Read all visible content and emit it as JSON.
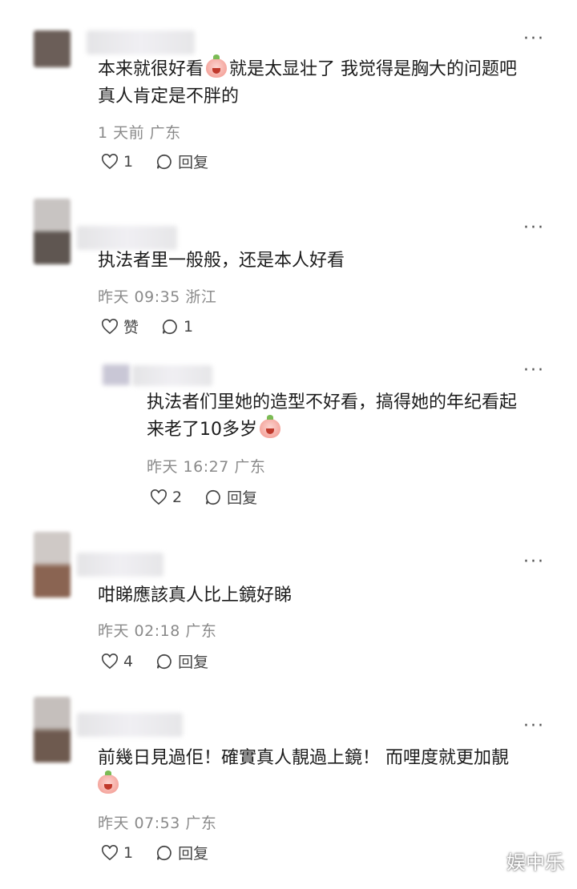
{
  "comments": [
    {
      "line1_a": "本来就很好看",
      "line1_b": "就是太显壮了 我觉得是胸大的问题吧",
      "line2": "真人肯定是不胖的",
      "meta": "1 天前 广东",
      "like_label": "1",
      "reply_label": "回复"
    },
    {
      "line1": "执法者里一般般，还是本人好看",
      "meta": "昨天 09:35 浙江",
      "like_label": "赞",
      "reply_label": "1"
    },
    {
      "line1": "执法者们里她的造型不好看，搞得她的年纪看起",
      "line2": "来老了10多岁",
      "meta": "昨天 16:27 广东",
      "like_label": "2",
      "reply_label": "回复"
    },
    {
      "line1": "咁睇應該真人比上鏡好睇",
      "meta": "昨天 02:18 广东",
      "like_label": "4",
      "reply_label": "回复"
    },
    {
      "line1": "前幾日見過佢！確實真人靚過上鏡！ 而哩度就更加靚",
      "meta": "昨天 07:53 广东",
      "like_label": "1",
      "reply_label": "回复"
    }
  ],
  "more_label": "···",
  "watermark": "娱中乐"
}
